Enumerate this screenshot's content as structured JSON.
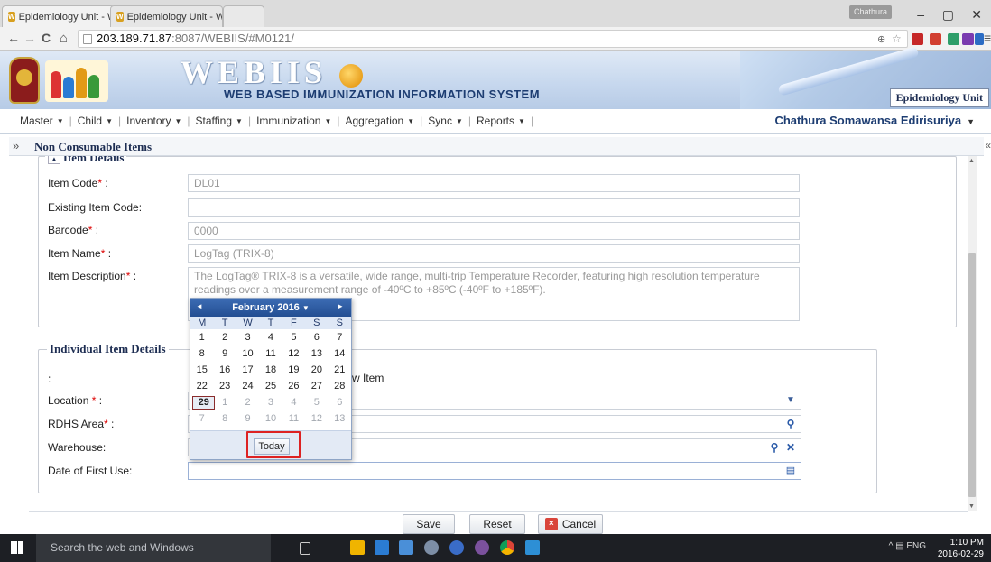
{
  "browser": {
    "tabs": [
      {
        "label": "Epidemiology Unit - WEBI",
        "close": "×"
      },
      {
        "label": "Epidemiology Unit - WEBI",
        "close": "×"
      }
    ],
    "profile_name": "Chathura",
    "window_controls": {
      "minimize": "–",
      "maximize": "▢",
      "close": "✕"
    },
    "nav": {
      "back": "←",
      "forward": "→",
      "reload": "C",
      "home": "⌂"
    },
    "url_host": "203.189.71.87",
    "url_path": ":8087/WEBIIS/#M0121/",
    "menu_icon": "≡"
  },
  "banner": {
    "title": "WEBIIS",
    "subtitle": "WEB BASED IMMUNIZATION INFORMATION SYSTEM",
    "unit_label": "Epidemiology Unit"
  },
  "menu": {
    "items": [
      {
        "label": "Master"
      },
      {
        "label": "Child"
      },
      {
        "label": "Inventory"
      },
      {
        "label": "Staffing"
      },
      {
        "label": "Immunization"
      },
      {
        "label": "Aggregation"
      },
      {
        "label": "Sync"
      },
      {
        "label": "Reports"
      }
    ],
    "caret": "▼",
    "user_name": "Chathura Somawansa Edirisuriya"
  },
  "page": {
    "expand_icon": "»",
    "title": "Non Consumable Items",
    "collapse_icon": "«"
  },
  "item_details": {
    "legend": "Item Details",
    "legend_toggle": "▲",
    "fields": {
      "item_code": {
        "label": "Item Code",
        "value": "DL01"
      },
      "existing_item_code": {
        "label": "Existing Item Code:",
        "value": ""
      },
      "barcode": {
        "label": "Barcode",
        "value": "0000"
      },
      "item_name": {
        "label": "Item Name",
        "value": "LogTag (TRIX-8)"
      },
      "item_description": {
        "label": "Item Description",
        "value": "The LogTag® TRIX-8 is a versatile, wide range, multi-trip Temperature Recorder, featuring high resolution temperature readings over a measurement range of -40ºC to +85ºC (-40ºF to +185ºF)."
      }
    },
    "required_mark": "*",
    "colon": ":"
  },
  "individual_details": {
    "legend": "Individual Item Details",
    "option_label": ":",
    "option_text": "w Item",
    "fields": {
      "location": {
        "label": "Location",
        "value": ""
      },
      "rdhs_area": {
        "label": "RDHS Area",
        "value": ""
      },
      "warehouse": {
        "label": "Warehouse:",
        "value": ""
      },
      "date_first_use": {
        "label": "Date of First Use:",
        "value": ""
      }
    }
  },
  "datepicker": {
    "month_label": "February 2016",
    "month_caret": "▼",
    "prev": "◄",
    "next": "►",
    "weekdays": [
      "M",
      "T",
      "W",
      "T",
      "F",
      "S",
      "S"
    ],
    "weeks": [
      [
        "1",
        "2",
        "3",
        "4",
        "5",
        "6",
        "7"
      ],
      [
        "8",
        "9",
        "10",
        "11",
        "12",
        "13",
        "14"
      ],
      [
        "15",
        "16",
        "17",
        "18",
        "19",
        "20",
        "21"
      ],
      [
        "22",
        "23",
        "24",
        "25",
        "26",
        "27",
        "28"
      ],
      [
        "29",
        "1",
        "2",
        "3",
        "4",
        "5",
        "6"
      ],
      [
        "7",
        "8",
        "9",
        "10",
        "11",
        "12",
        "13"
      ]
    ],
    "selected_day": "29",
    "today_label": "Today"
  },
  "buttons": {
    "save": "Save",
    "reset": "Reset",
    "cancel": "Cancel",
    "cancel_icon": "×"
  },
  "taskbar": {
    "search_placeholder": "Search the web and Windows",
    "tray_text": "^ ▤ ENG",
    "time": "1:10 PM",
    "date": "2016-02-29"
  },
  "colors": {
    "accent": "#234e92",
    "title_text": "#1d2d52",
    "required": "#dd0000",
    "highlight": "#dd2222"
  }
}
